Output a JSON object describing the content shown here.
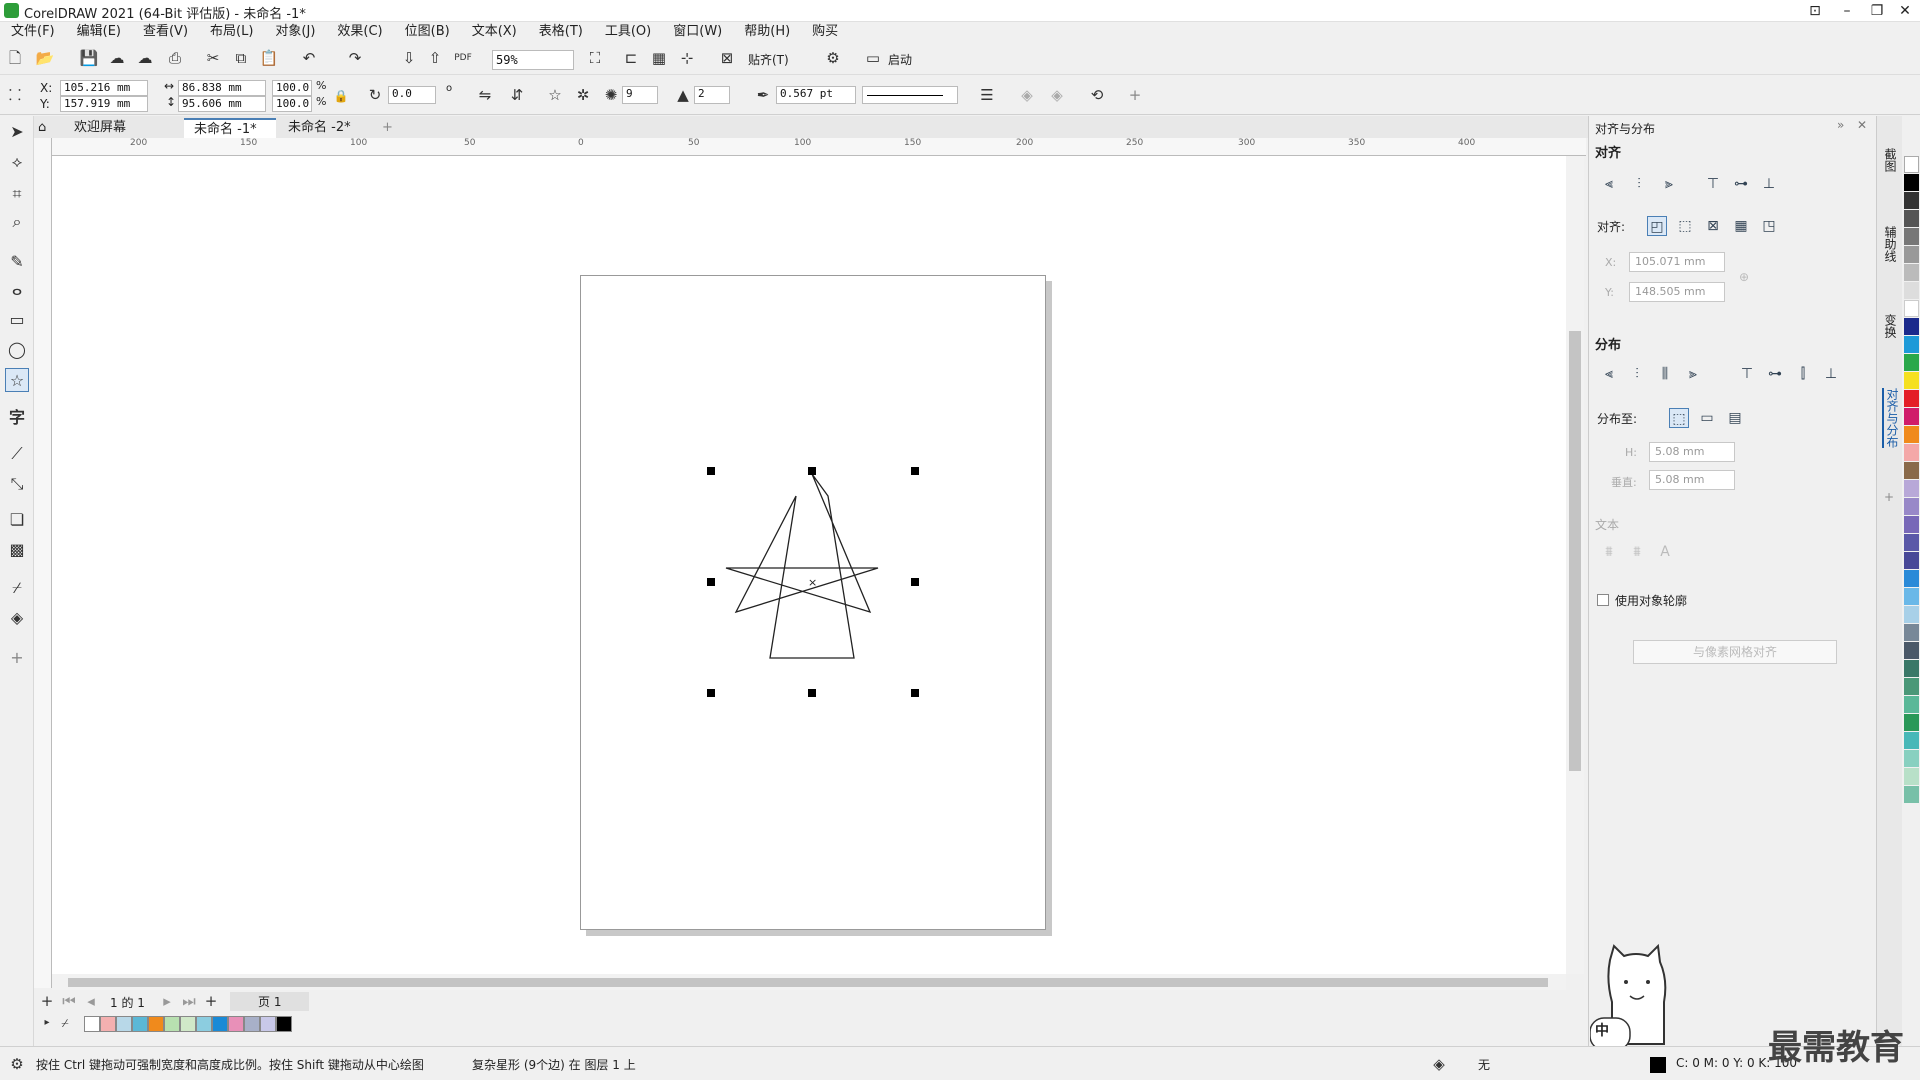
{
  "window": {
    "title": "CorelDRAW 2021 (64-Bit 评估版) - 未命名 -1*"
  },
  "menu": [
    "文件(F)",
    "编辑(E)",
    "查看(V)",
    "布局(L)",
    "对象(J)",
    "效果(C)",
    "位图(B)",
    "文本(X)",
    "表格(T)",
    "工具(O)",
    "窗口(W)",
    "帮助(H)",
    "购买"
  ],
  "toolbar": {
    "zoom": "59%",
    "snap": "贴齐(T)",
    "launch": "启动"
  },
  "props": {
    "x": "105.216 mm",
    "y": "157.919 mm",
    "w": "86.838 mm",
    "h": "95.606 mm",
    "sx": "100.0",
    "sy": "100.0",
    "pct": "%",
    "rotation": "0.0",
    "points": "9",
    "sharpness": "2",
    "outline": "0.567 pt",
    "x_label": "X:",
    "y_label": "Y:"
  },
  "tabs": [
    "欢迎屏幕",
    "未命名 -1*",
    "未命名 -2*"
  ],
  "ruler": [
    "200",
    "150",
    "100",
    "50",
    "0",
    "50",
    "100",
    "150",
    "200",
    "250",
    "300",
    "350",
    "400"
  ],
  "pagenav": {
    "count": "1 的 1",
    "page": "页 1"
  },
  "panel": {
    "title": "对齐与分布",
    "align_h": "对齐",
    "align_to": "对齐:",
    "x_label": "X:",
    "x_val": "105.071 mm",
    "y_label": "Y:",
    "y_val": "148.505 mm",
    "distribute": "分布",
    "dist_to": "分布至:",
    "h_label": "H:",
    "h_val": "5.08 mm",
    "v_label": "垂直:",
    "v_val": "5.08 mm",
    "text": "文本",
    "use_outline": "使用对象轮廓",
    "grid_btn": "与像素网格对齐"
  },
  "sidetabs": [
    "截图",
    "辅助线",
    "变换",
    "对齐与分布"
  ],
  "status": {
    "hint": "按住 Ctrl 键拖动可强制宽度和高度成比例。按住 Shift 键拖动从中心绘图",
    "object": "复杂星形 (9个边) 在 图层 1 上",
    "fill": "无",
    "cmyk": "C: 0 M: 0 Y: 0 K: 100"
  },
  "ime": "中",
  "watermark": "最需教育",
  "colors": {
    "accent": "#4a7fb5",
    "page_bg": "#ffffff",
    "canvas_bg": "#ffffff"
  }
}
